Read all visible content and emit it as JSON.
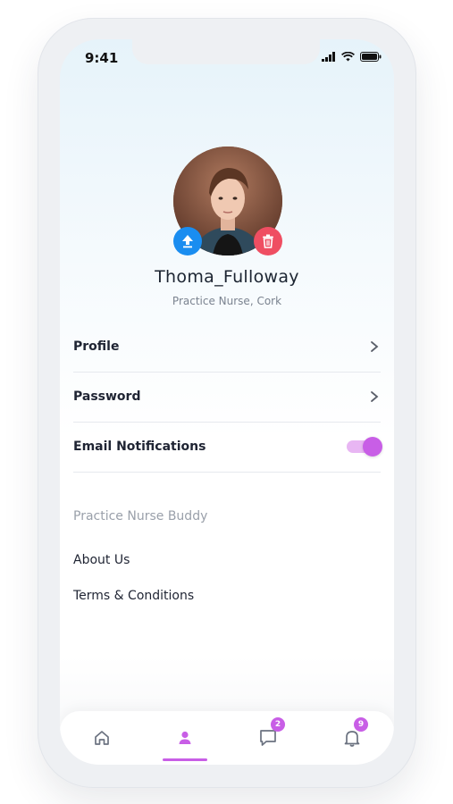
{
  "status_bar": {
    "time": "9:41"
  },
  "profile": {
    "username": "Thoma_Fulloway",
    "subtitle": "Practice Nurse, Cork"
  },
  "settings": [
    {
      "label": "Profile",
      "control": "chevron"
    },
    {
      "label": "Password",
      "control": "chevron"
    },
    {
      "label": "Email Notifications",
      "control": "toggle",
      "enabled": true
    }
  ],
  "about_section": {
    "title": "Practice Nurse Buddy",
    "links": [
      "About Us",
      "Terms & Conditions"
    ]
  },
  "tabbar": {
    "tabs": [
      {
        "icon": "home-icon"
      },
      {
        "icon": "user-icon",
        "active": true
      },
      {
        "icon": "chat-icon",
        "badge": "2"
      },
      {
        "icon": "bell-icon",
        "badge": "9"
      }
    ]
  },
  "colors": {
    "accent": "#c85ee6",
    "upload": "#1a8df0",
    "delete": "#ef4e62"
  }
}
